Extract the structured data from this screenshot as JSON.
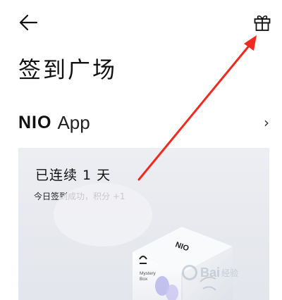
{
  "header": {
    "back_icon": "arrow-left-icon",
    "gift_icon": "gift-icon"
  },
  "page": {
    "title": "签到广场"
  },
  "brand": {
    "logo_text": "NIO",
    "app_text": "App",
    "chevron_icon": "chevron-right-icon",
    "chevron_glyph": "›"
  },
  "checkin_card": {
    "title": "已连续 1 天",
    "subtitle": "今日签到成功，积分 +1",
    "box_label_line1": "Mystery",
    "box_label_line2": "Box",
    "box_brand": "NIO"
  },
  "annotation": {
    "arrow_color": "#f02a1e"
  },
  "watermark": {
    "text": "Bai",
    "suffix": "经验"
  }
}
